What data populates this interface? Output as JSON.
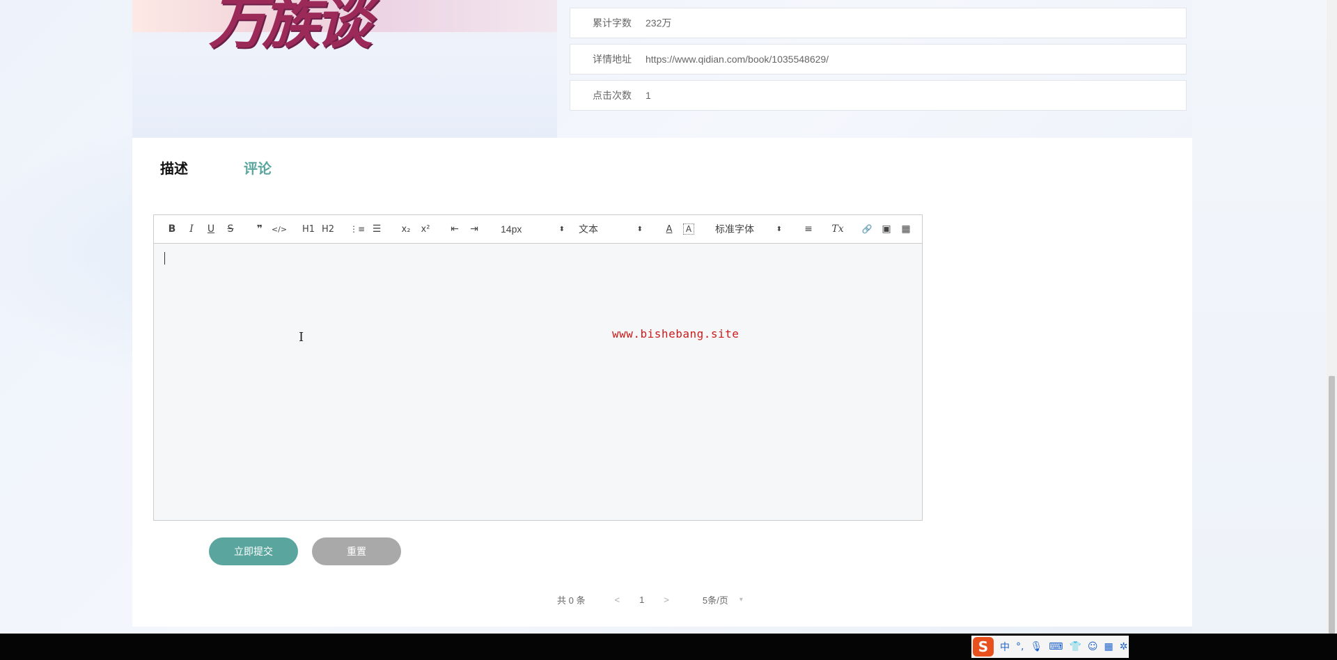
{
  "book_info": {
    "rows": [
      {
        "label": "累计字数",
        "value": "232万"
      },
      {
        "label": "详情地址",
        "value": "https://www.qidian.com/book/1035548629/"
      },
      {
        "label": "点击次数",
        "value": "1"
      }
    ]
  },
  "tabs": {
    "description": "描述",
    "comment": "评论"
  },
  "editor": {
    "toolbar": {
      "bold": "B",
      "italic": "I",
      "underline": "U",
      "strike": "S",
      "blockquote": "❞",
      "code": "</>",
      "h1": "H1",
      "h2": "H2",
      "ordered_list": "⋮≡",
      "bullet_list": "☰",
      "subscript": "x₂",
      "superscript": "x²",
      "outdent": "⇤",
      "indent": "⇥",
      "font_size": "14px",
      "header_select": "文本",
      "font_color": "A",
      "background_color": "A",
      "font_family": "标准字体",
      "align": "≡",
      "clean": "Tx",
      "link": "🔗",
      "image": "▣",
      "video": "▦"
    },
    "watermark": "www.bishebang.site",
    "icons": {
      "link": "link-icon",
      "image": "image-icon",
      "video": "video-icon"
    }
  },
  "buttons": {
    "submit": "立即提交",
    "reset": "重置"
  },
  "pagination": {
    "total": "共 0 条",
    "prev": "<",
    "current_page": "1",
    "next": ">",
    "page_size": "5条/页"
  },
  "taskbar": {
    "ime_logo": "S",
    "ime_mode": "中",
    "ime_punct": "°,"
  },
  "colors": {
    "accent": "#5aa69e",
    "reset_gray": "#a9a9a9",
    "watermark_red": "#cc1b1b"
  }
}
